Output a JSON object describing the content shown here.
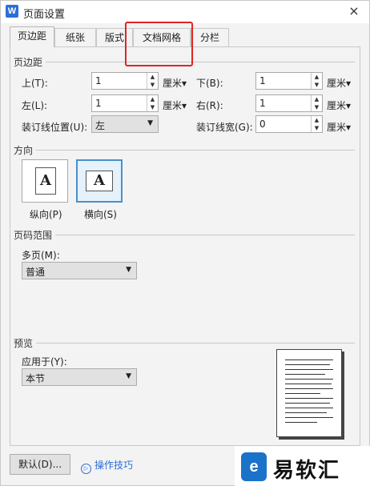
{
  "window": {
    "title": "页面设置",
    "app_icon": "W",
    "close_icon": "×"
  },
  "tabs": [
    {
      "label": "页边距",
      "active": true
    },
    {
      "label": "纸张",
      "active": false
    },
    {
      "label": "版式",
      "active": false
    },
    {
      "label": "文档网格",
      "active": false
    },
    {
      "label": "分栏",
      "active": false
    }
  ],
  "margins": {
    "section": "页边距",
    "top": {
      "label": "上(T):",
      "value": "1",
      "unit": "厘米▾"
    },
    "bottom": {
      "label": "下(B):",
      "value": "1",
      "unit": "厘米▾"
    },
    "left": {
      "label": "左(L):",
      "value": "1",
      "unit": "厘米▾"
    },
    "right": {
      "label": "右(R):",
      "value": "1",
      "unit": "厘米▾"
    },
    "gutter_pos": {
      "label": "装订线位置(U):",
      "value": "左"
    },
    "gutter": {
      "label": "装订线宽(G):",
      "value": "0",
      "unit": "厘米▾"
    }
  },
  "orientation": {
    "section": "方向",
    "portrait": {
      "label": "纵向(P)",
      "glyph": "A",
      "selected": false
    },
    "landscape": {
      "label": "横向(S)",
      "glyph": "A",
      "selected": true
    }
  },
  "page_range": {
    "section": "页码范围",
    "multi_label": "多页(M):",
    "multi_value": "普通"
  },
  "preview": {
    "section": "预览",
    "apply_label": "应用于(Y):",
    "apply_value": "本节"
  },
  "footer": {
    "default_button": "默认(D)...",
    "tips_link": "操作技巧",
    "tips_icon": "▷"
  },
  "watermark": {
    "logo": "e",
    "text": "易软汇"
  },
  "colors": {
    "accent": "#2b6fd6",
    "highlight_box": "#e02424",
    "selected_border": "#4a90c8"
  }
}
